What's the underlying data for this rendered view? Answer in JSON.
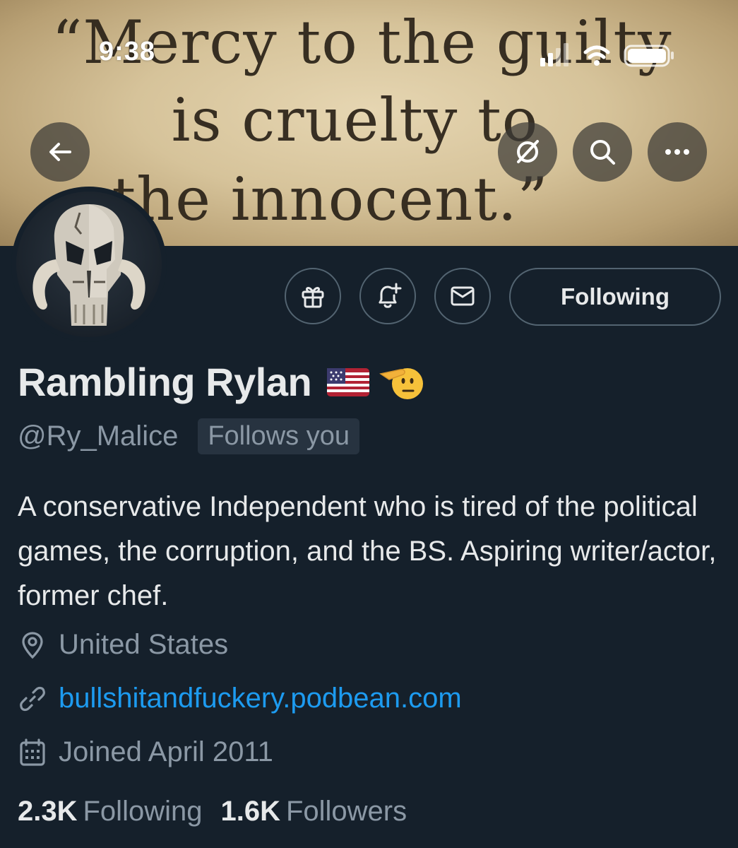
{
  "status_bar": {
    "time": "9:38"
  },
  "banner": {
    "quote_lines": [
      "“Mercy to the guilty",
      "is cruelty to",
      "the innocent.”"
    ]
  },
  "actions": {
    "following_label": "Following"
  },
  "profile": {
    "display_name": "Rambling Rylan",
    "name_emojis": [
      "🇺🇸",
      "🫡"
    ],
    "handle": "@Ry_Malice",
    "follows_you": "Follows you",
    "bio": "A conservative Independent who is tired of the political games, the corruption, and the BS. Aspiring writer/actor, former chef.",
    "location": "United States",
    "website": "bullshitandfuckery.podbean.com",
    "joined": "Joined April 2011"
  },
  "stats": {
    "following_count": "2.3K",
    "following_label": "Following",
    "followers_count": "1.6K",
    "followers_label": "Followers"
  },
  "colors": {
    "background": "#15202b",
    "primary_text": "#e7e9ea",
    "secondary_text": "#8b98a5",
    "link": "#1d9bf0",
    "border": "#536471"
  },
  "icons": [
    "back-arrow-icon",
    "grok-icon",
    "search-icon",
    "more-icon",
    "gift-icon",
    "bell-plus-icon",
    "mail-icon",
    "location-pin-icon",
    "link-icon",
    "calendar-icon"
  ]
}
